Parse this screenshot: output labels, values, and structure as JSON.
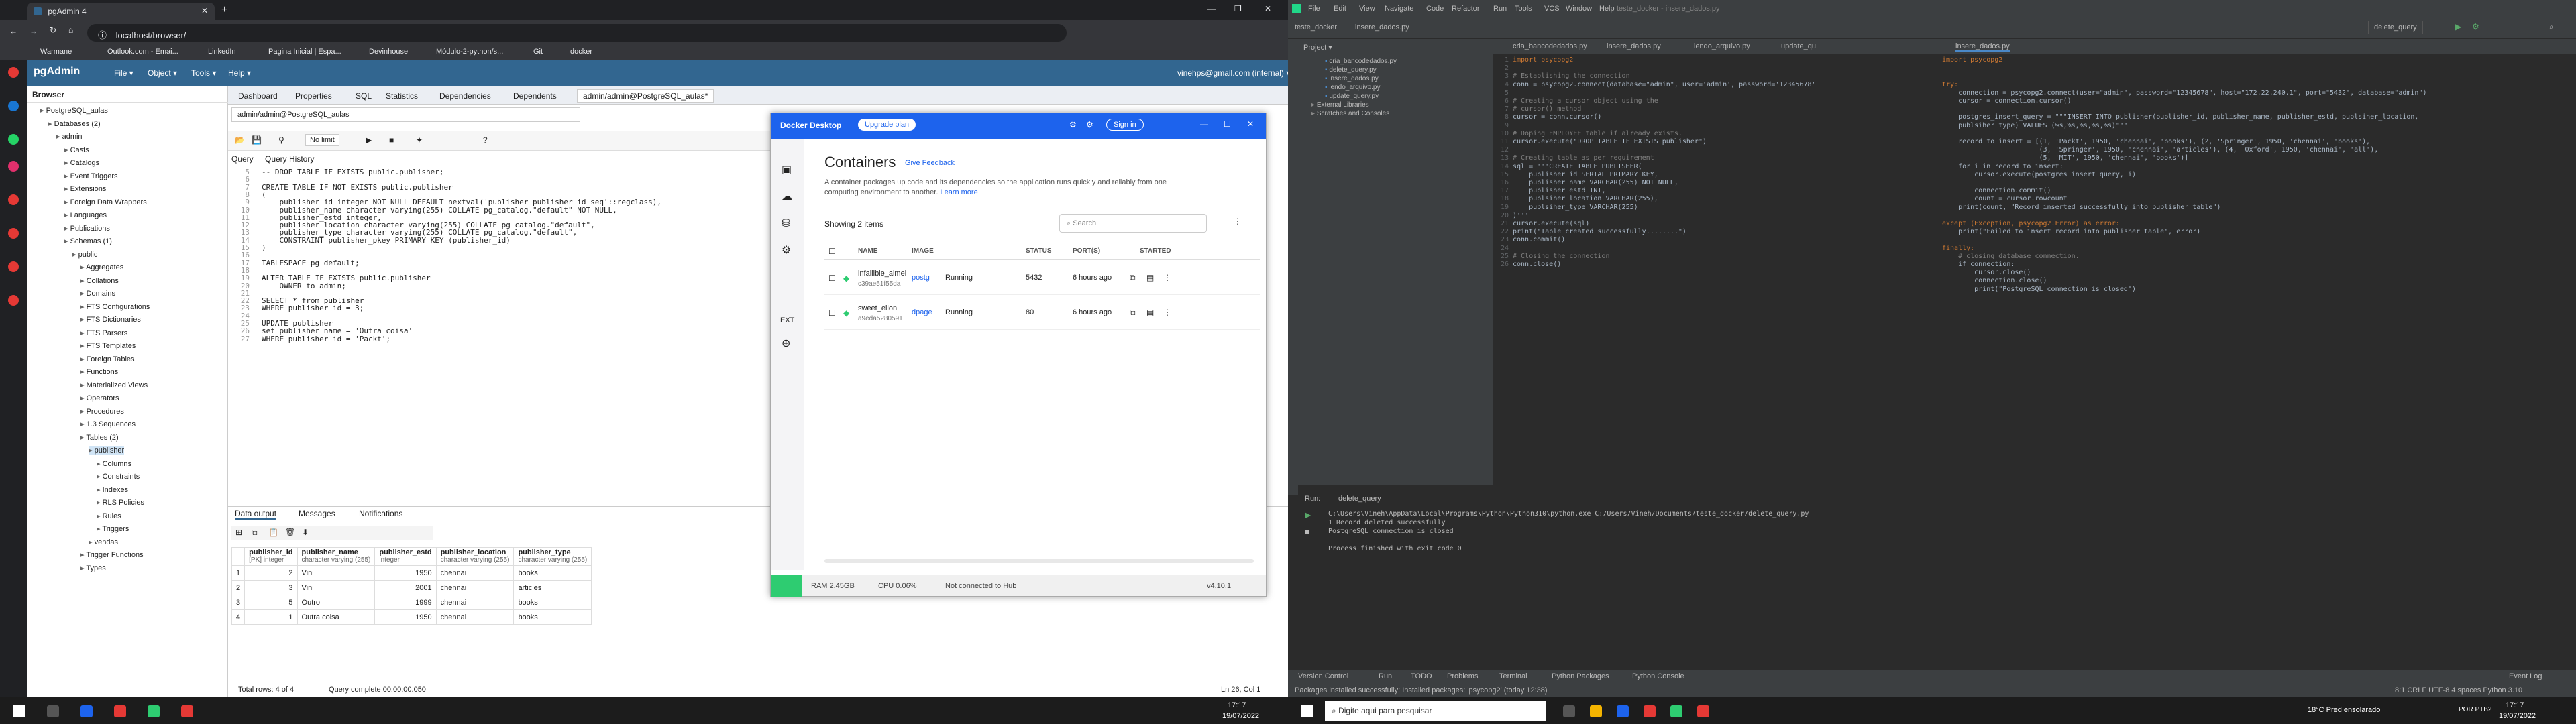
{
  "browser": {
    "tabs": [
      "pgAdmin 4"
    ],
    "url": "localhost/browser/",
    "bookmarks": [
      "Warmane",
      "Outlook.com - Emai...",
      "LinkedIn",
      "Pagina Inicial | Espa...",
      "Devinhouse",
      "Módulo-2-python/s...",
      "Git",
      "docker"
    ]
  },
  "pgadmin": {
    "logo": "pgAdmin",
    "menu": [
      "File ▾",
      "Object ▾",
      "Tools ▾",
      "Help ▾"
    ],
    "user": "vinehps@gmail.com (internal) ▾",
    "browser_title": "Browser",
    "tree": [
      {
        "label": "PostgreSQL_aulas",
        "indent": 1
      },
      {
        "label": "Databases (2)",
        "indent": 2
      },
      {
        "label": "admin",
        "indent": 3
      },
      {
        "label": "Casts",
        "indent": 4
      },
      {
        "label": "Catalogs",
        "indent": 4
      },
      {
        "label": "Event Triggers",
        "indent": 4
      },
      {
        "label": "Extensions",
        "indent": 4
      },
      {
        "label": "Foreign Data Wrappers",
        "indent": 4
      },
      {
        "label": "Languages",
        "indent": 4
      },
      {
        "label": "Publications",
        "indent": 4
      },
      {
        "label": "Schemas (1)",
        "indent": 4
      },
      {
        "label": "public",
        "indent": 5
      },
      {
        "label": "Aggregates",
        "indent": 6
      },
      {
        "label": "Collations",
        "indent": 6
      },
      {
        "label": "Domains",
        "indent": 6
      },
      {
        "label": "FTS Configurations",
        "indent": 6
      },
      {
        "label": "FTS Dictionaries",
        "indent": 6
      },
      {
        "label": "FTS Parsers",
        "indent": 6
      },
      {
        "label": "FTS Templates",
        "indent": 6
      },
      {
        "label": "Foreign Tables",
        "indent": 6
      },
      {
        "label": "Functions",
        "indent": 6
      },
      {
        "label": "Materialized Views",
        "indent": 6
      },
      {
        "label": "Operators",
        "indent": 6
      },
      {
        "label": "Procedures",
        "indent": 6
      },
      {
        "label": "1.3 Sequences",
        "indent": 6
      },
      {
        "label": "Tables (2)",
        "indent": 6
      },
      {
        "label": "publisher",
        "indent": 7
      },
      {
        "label": "Columns",
        "indent": 8
      },
      {
        "label": "Constraints",
        "indent": 8
      },
      {
        "label": "Indexes",
        "indent": 8
      },
      {
        "label": "RLS Policies",
        "indent": 8
      },
      {
        "label": "Rules",
        "indent": 8
      },
      {
        "label": "Triggers",
        "indent": 8
      },
      {
        "label": "vendas",
        "indent": 7
      },
      {
        "label": "Trigger Functions",
        "indent": 6
      },
      {
        "label": "Types",
        "indent": 6
      }
    ],
    "panel_tabs": [
      "Dashboard",
      "Properties",
      "SQL",
      "Statistics",
      "Dependencies",
      "Dependents",
      "admin/admin@PostgreSQL_aulas*"
    ],
    "connection": "admin/admin@PostgreSQL_aulas",
    "limit": "No limit",
    "query_tabs": [
      "Query",
      "Query History"
    ],
    "code_lines": [
      "-- DROP TABLE IF EXISTS public.publisher;",
      "",
      "CREATE TABLE IF NOT EXISTS public.publisher",
      "(",
      "    publisher_id integer NOT NULL DEFAULT nextval('publisher_publisher_id_seq'::regclass),",
      "    publisher_name character varying(255) COLLATE pg_catalog.\"default\" NOT NULL,",
      "    publisher_estd integer,",
      "    publisher_location character varying(255) COLLATE pg_catalog.\"default\",",
      "    publisher_type character varying(255) COLLATE pg_catalog.\"default\",",
      "    CONSTRAINT publisher_pkey PRIMARY KEY (publisher_id)",
      ")",
      "",
      "TABLESPACE pg_default;",
      "",
      "ALTER TABLE IF EXISTS public.publisher",
      "    OWNER to admin;",
      "",
      "SELECT * from publisher",
      "WHERE publisher_id = 3;",
      "",
      "UPDATE publisher",
      "set publisher_name = 'Outra coisa'",
      "WHERE publisher_id = 'Packt';"
    ],
    "line_numbers": [
      "5",
      "6",
      "7",
      "8",
      "9",
      "10",
      "11",
      "12",
      "13",
      "14",
      "15",
      "16",
      "17",
      "18",
      "19",
      "20",
      "21",
      "22",
      "23",
      "24",
      "25",
      "26",
      "27"
    ],
    "output_tabs": [
      "Data output",
      "Messages",
      "Notifications"
    ],
    "columns": [
      {
        "name": "publisher_id",
        "type": "[PK] integer"
      },
      {
        "name": "publisher_name",
        "type": "character varying (255)"
      },
      {
        "name": "publisher_estd",
        "type": "integer"
      },
      {
        "name": "publisher_location",
        "type": "character varying (255)"
      },
      {
        "name": "publisher_type",
        "type": "character varying (255)"
      }
    ],
    "rows": [
      [
        "1",
        "2",
        "Vini",
        "1950",
        "chennai",
        "books"
      ],
      [
        "2",
        "3",
        "Vini",
        "2001",
        "chennai",
        "articles"
      ],
      [
        "3",
        "5",
        "Outro",
        "1999",
        "chennai",
        "books"
      ],
      [
        "4",
        "1",
        "Outra coisa",
        "1950",
        "chennai",
        "books"
      ]
    ],
    "status_left": "Total rows: 4 of 4",
    "status_mid": "Query complete 00:00:00.050",
    "status_right": "Ln 26, Col 1"
  },
  "docker": {
    "title": "Docker Desktop",
    "upgrade": "Upgrade plan",
    "signin": "Sign in",
    "heading": "Containers",
    "feedback": "Give Feedback",
    "description": "A container packages up code and its dependencies so the application runs quickly and reliably from one computing environment to another.",
    "learn_more": "Learn more",
    "showing": "Showing 2 items",
    "search_placeholder": "Search",
    "columns": [
      "NAME",
      "IMAGE",
      "STATUS",
      "PORT(S)",
      "STARTED"
    ],
    "containers": [
      {
        "name": "infallible_almei",
        "id": "c39ae51f55da",
        "image": "postg",
        "status": "Running",
        "port": "5432",
        "started": "6 hours ago"
      },
      {
        "name": "sweet_ellon",
        "id": "a9eda5280591",
        "image": "dpage",
        "status": "Running",
        "port": "80",
        "started": "6 hours ago"
      }
    ],
    "ext": "EXT",
    "ram": "RAM 2.45GB",
    "cpu": "CPU 0.06%",
    "hub": "Not connected to Hub",
    "version": "v4.10.1"
  },
  "pycharm": {
    "menu": [
      "File",
      "Edit",
      "View",
      "Navigate",
      "Code",
      "Refactor",
      "Run",
      "Tools",
      "VCS",
      "Window",
      "Help"
    ],
    "window_title": "teste_docker - insere_dados.py",
    "breadcrumb": [
      "teste_docker",
      "insere_dados.py"
    ],
    "run_config": "delete_query",
    "project_label": "Project ▾",
    "files": [
      "cria_bancodedados.py",
      "delete_query.py",
      "insere_dados.py",
      "lendo_arquivo.py",
      "update_query.py",
      "External Libraries",
      "Scratches and Consoles"
    ],
    "editor_tabs": [
      "cria_bancodedados.py",
      "insere_dados.py",
      "lendo_arquivo.py",
      "update_qu",
      "insere_dados.py"
    ],
    "left_code": [
      "import psycopg2",
      "",
      "# Establishing the connection",
      "conn = psycopg2.connect(database=\"admin\", user='admin', password='12345678'",
      "",
      "# Creating a cursor object using the",
      "# cursor() method",
      "cursor = conn.cursor()",
      "",
      "# Doping EMPLOYEE table if already exists.",
      "cursor.execute(\"DROP TABLE IF EXISTS publisher\")",
      "",
      "# Creating table as per requirement",
      "sql = '''CREATE TABLE PUBLISHER(",
      "    publisher_id SERIAL PRIMARY KEY,",
      "    publisher_name VARCHAR(255) NOT NULL,",
      "    publisher_estd INT,",
      "    publsiher_location VARCHAR(255),",
      "    publsiher_type VARCHAR(255)",
      ")'''",
      "cursor.execute(sql)",
      "print(\"Table created successfully........\")",
      "conn.commit()",
      "",
      "# Closing the connection",
      "conn.close()"
    ],
    "left_linenos": [
      "1",
      "2",
      "3",
      "4",
      "5",
      "6",
      "7",
      "8",
      "9",
      "10",
      "11",
      "12",
      "13",
      "14",
      "15",
      "16",
      "17",
      "18",
      "19",
      "20",
      "21",
      "22",
      "23",
      "24",
      "25",
      "26"
    ],
    "right_code": [
      "import psycopg2",
      "",
      "",
      "try:",
      "    connection = psycopg2.connect(user=\"admin\", password=\"12345678\", host=\"172.22.240.1\", port=\"5432\", database=\"admin\")",
      "    cursor = connection.cursor()",
      "",
      "    postgres_insert_query = \"\"\"INSERT INTO publisher(publisher_id, publisher_name, publisher_estd, publsiher_location,",
      "    publsiher_type) VALUES (%s,%s,%s,%s,%s)\"\"\"",
      "",
      "    record_to_insert = [(1, 'Packt', 1950, 'chennai', 'books'), (2, 'Springer', 1950, 'chennai', 'books'),",
      "                        (3, 'Springer', 1950, 'chennai', 'articles'), (4, 'Oxford', 1950, 'chennai', 'all'),",
      "                        (5, 'MIT', 1950, 'chennai', 'books')]",
      "    for i in record_to_insert:",
      "        cursor.execute(postgres_insert_query, i)",
      "",
      "        connection.commit()",
      "        count = cursor.rowcount",
      "    print(count, \"Record inserted successfully into publisher table\")",
      "",
      "except (Exception, psycopg2.Error) as error:",
      "    print(\"Failed to insert record into publisher table\", error)",
      "",
      "finally:",
      "    # closing database connection.",
      "    if connection:",
      "        cursor.close()",
      "        connection.close()",
      "        print(\"PostgreSQL connection is closed\")"
    ],
    "run_tab": "Run:",
    "run_name": "delete_query",
    "console": [
      "C:\\Users\\Vineh\\AppData\\Local\\Programs\\Python\\Python310\\python.exe C:/Users/Vineh/Documents/teste_docker/delete_query.py",
      "1 Record deleted successfully",
      "PostgreSQL connection is closed",
      "",
      "Process finished with exit code 0"
    ],
    "bottom_tabs": [
      "Version Control",
      "Run",
      "TODO",
      "Problems",
      "Terminal",
      "Python Packages",
      "Python Console"
    ],
    "event_log": "Event Log",
    "status_msg": "Packages installed successfully: Installed packages: 'psycopg2' (today 12:38)",
    "status_right": "8:1  CRLF  UTF-8  4 spaces  Python 3.10"
  },
  "taskbar": {
    "search": "Digite aqui para pesquisar",
    "weather": "18°C  Pred ensolarado",
    "lang": "POR PTB2",
    "time": "17:17",
    "date": "19/07/2022"
  }
}
